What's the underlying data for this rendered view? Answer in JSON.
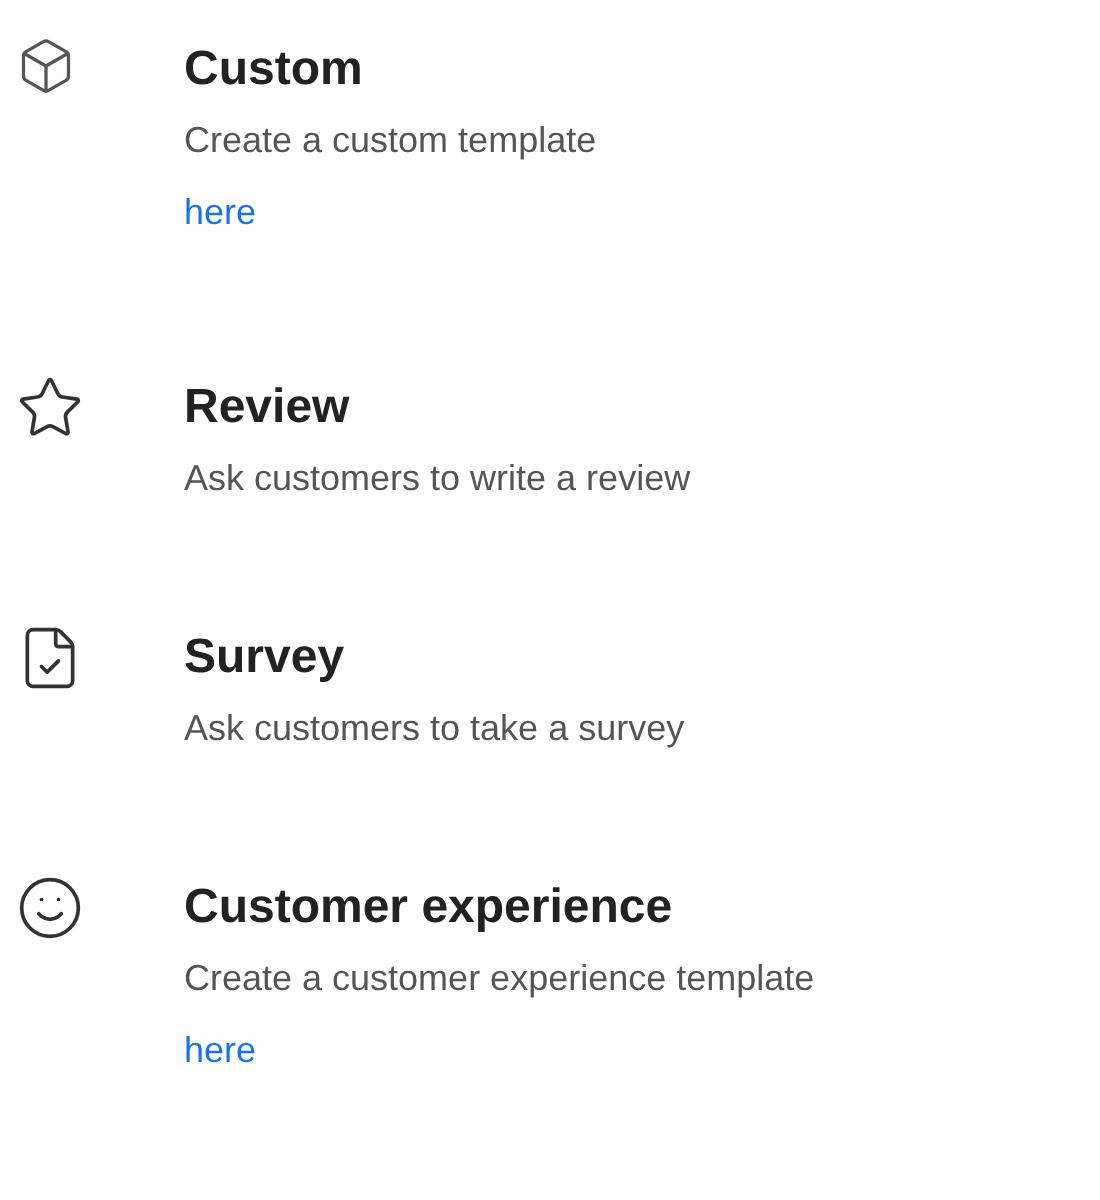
{
  "templates": [
    {
      "kind": "custom",
      "title": "Custom",
      "description": "Create a custom template",
      "link": "here"
    },
    {
      "kind": "review",
      "title": "Review",
      "description": "Ask customers to write a review"
    },
    {
      "kind": "survey",
      "title": "Survey",
      "description": "Ask customers to take a survey"
    },
    {
      "kind": "experience",
      "title": "Customer experience",
      "description": "Create a customer experience template",
      "link": "here"
    }
  ]
}
